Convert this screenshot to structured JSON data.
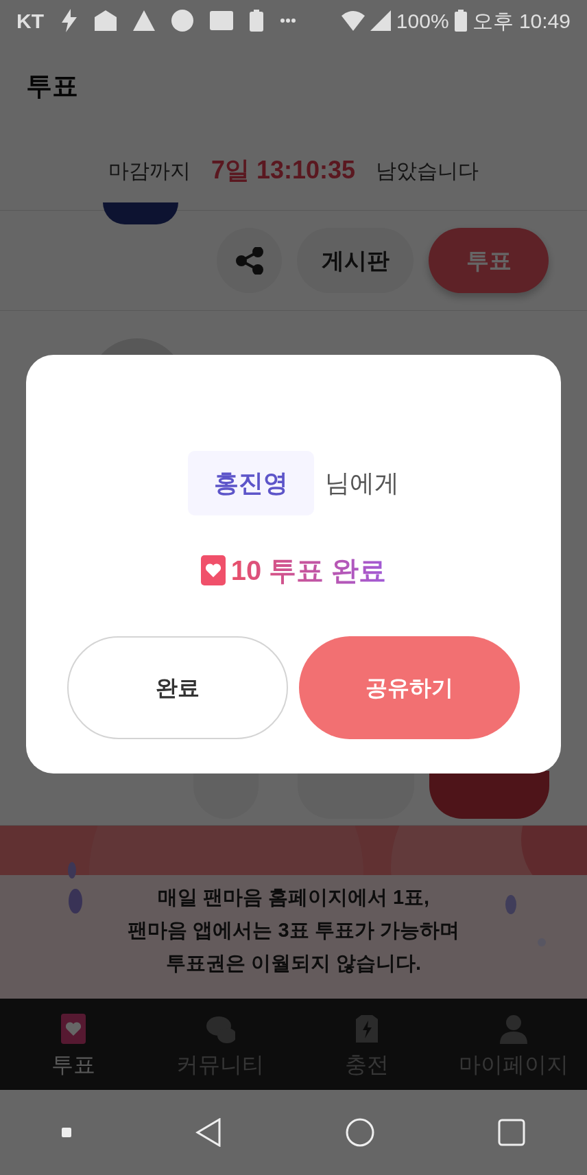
{
  "status_bar": {
    "carrier": "KT",
    "battery": "100%",
    "time": "오후 10:49"
  },
  "header": {
    "title": "투표"
  },
  "deadline": {
    "label": "마감까지",
    "remaining": "7일 13:10:35",
    "suffix": "남았습니다"
  },
  "candidate_actions": [
    {
      "kind": "share"
    },
    {
      "kind": "board",
      "label": "게시판"
    },
    {
      "kind": "vote",
      "label": "투표"
    }
  ],
  "banner": {
    "lines": [
      "매일 팬마음 홈페이지에서 1표,",
      "팬마음 앱에서는 3표 투표가 가능하며",
      "투표권은 이월되지 않습니다."
    ]
  },
  "modal": {
    "recipient": "홍진영",
    "recipient_suffix": "님에게",
    "result": "10 투표 완료",
    "buttons": [
      {
        "kind": "secondary",
        "label": "완료"
      },
      {
        "kind": "primary",
        "label": "공유하기"
      }
    ]
  },
  "tab_bar": [
    {
      "kind": "vote",
      "label": "투표",
      "selected": true
    },
    {
      "kind": "community",
      "label": "커뮤니티",
      "selected": false
    },
    {
      "kind": "charge",
      "label": "충전",
      "selected": false
    },
    {
      "kind": "profile",
      "label": "마이페이지",
      "selected": false
    }
  ]
}
